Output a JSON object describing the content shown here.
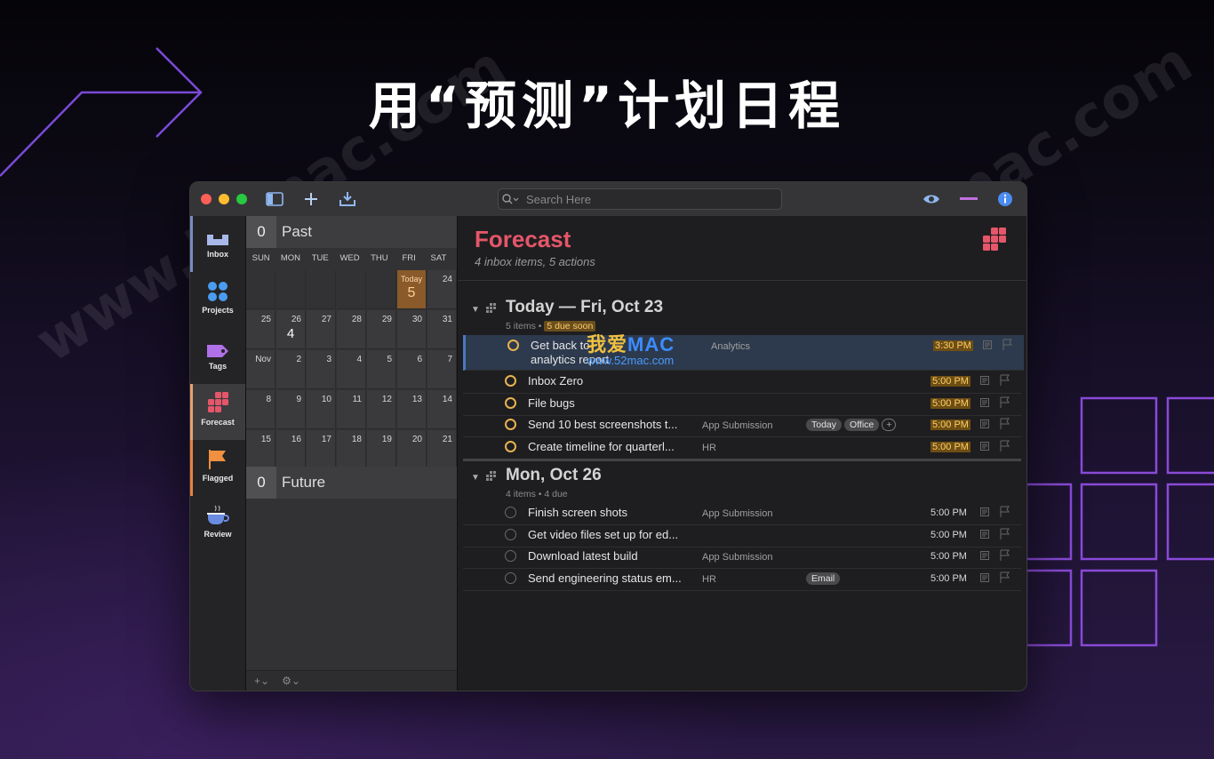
{
  "banner": {
    "title": "用“预测”计划日程"
  },
  "watermarks": {
    "left": "www.52mac.com",
    "right": "www.52mac.com",
    "mac_logo_a": "我爱",
    "mac_logo_b": "MAC",
    "mac_url": "www.52mac.com"
  },
  "toolbar": {
    "search_placeholder": "Search Here"
  },
  "sidebar": {
    "items": [
      {
        "label": "Inbox",
        "icon": "inbox-icon"
      },
      {
        "label": "Projects",
        "icon": "projects-icon"
      },
      {
        "label": "Tags",
        "icon": "tag-icon"
      },
      {
        "label": "Forecast",
        "icon": "forecast-icon",
        "selected": true
      },
      {
        "label": "Flagged",
        "icon": "flag-icon"
      },
      {
        "label": "Review",
        "icon": "coffee-cup-icon"
      }
    ]
  },
  "calendar": {
    "past": {
      "count": "0",
      "label": "Past"
    },
    "future": {
      "count": "0",
      "label": "Future"
    },
    "weekdays": [
      "SUN",
      "MON",
      "TUE",
      "WED",
      "THU",
      "FRI",
      "SAT"
    ],
    "today_label": "Today",
    "today_count": "5",
    "mon26_count": "4",
    "days": [
      "24",
      "25",
      "26",
      "27",
      "28",
      "29",
      "30",
      "31",
      "Nov",
      "2",
      "3",
      "4",
      "5",
      "6",
      "7",
      "8",
      "9",
      "10",
      "11",
      "12",
      "13",
      "14",
      "15",
      "16",
      "17",
      "18",
      "19",
      "20",
      "21"
    ],
    "footer_add": "+⌄",
    "footer_gear": "⚙⌄"
  },
  "forecast": {
    "title": "Forecast",
    "subtitle": "4 inbox items, 5 actions",
    "groups": [
      {
        "title": "Today — Fri, Oct 23",
        "summary_a": "5 items • ",
        "summary_b": "5 due soon",
        "rows": [
          {
            "name": "Get back to Mike — create analytics report",
            "name_l1": "Get back to ",
            "name_l2": "analytics report",
            "project": "Analytics",
            "time": "3:30 PM"
          },
          {
            "name": "Inbox Zero",
            "project": "",
            "time": "5:00 PM"
          },
          {
            "name": "File bugs",
            "project": "",
            "time": "5:00 PM"
          },
          {
            "name": "Send 10 best screenshots t...",
            "project": "App Submission",
            "tags": [
              "Today",
              "Office",
              "+"
            ],
            "time": "5:00 PM"
          },
          {
            "name": "Create timeline for quarterl...",
            "project": "HR",
            "time": "5:00 PM"
          }
        ]
      },
      {
        "title": "Mon, Oct 26",
        "summary": "4 items • 4 due",
        "rows": [
          {
            "name": "Finish screen shots",
            "project": "App Submission",
            "time": "5:00 PM"
          },
          {
            "name": "Get video files set up for ed...",
            "project": "",
            "time": "5:00 PM"
          },
          {
            "name": "Download latest build",
            "project": "App Submission",
            "time": "5:00 PM"
          },
          {
            "name": "Send engineering status em...",
            "project": "HR",
            "tags": [
              "Email"
            ],
            "time": "5:00 PM"
          }
        ]
      }
    ]
  },
  "colors": {
    "accent": "#e5566a",
    "due": "#ffcf66",
    "today_cell": "#8a5a2a"
  }
}
